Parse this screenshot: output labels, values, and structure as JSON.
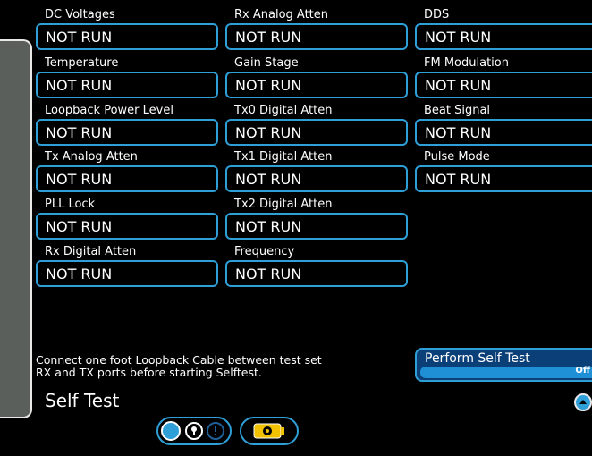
{
  "tests": {
    "dc_voltages": {
      "label": "DC Voltages",
      "value": "NOT RUN"
    },
    "temperature": {
      "label": "Temperature",
      "value": "NOT RUN"
    },
    "loopback_power_level": {
      "label": "Loopback Power Level",
      "value": "NOT RUN"
    },
    "tx_analog_atten": {
      "label": "Tx Analog Atten",
      "value": "NOT RUN"
    },
    "pll_lock": {
      "label": "PLL Lock",
      "value": "NOT RUN"
    },
    "rx_digital_atten": {
      "label": "Rx Digital Atten",
      "value": "NOT RUN"
    },
    "rx_analog_atten": {
      "label": "Rx Analog Atten",
      "value": "NOT RUN"
    },
    "gain_stage": {
      "label": "Gain Stage",
      "value": "NOT RUN"
    },
    "tx0_digital_atten": {
      "label": "Tx0 Digital Atten",
      "value": "NOT RUN"
    },
    "tx1_digital_atten": {
      "label": "Tx1 Digital Atten",
      "value": "NOT RUN"
    },
    "tx2_digital_atten": {
      "label": "Tx2 Digital Atten",
      "value": "NOT RUN"
    },
    "frequency": {
      "label": "Frequency",
      "value": "NOT RUN"
    },
    "dds": {
      "label": "DDS",
      "value": "NOT RUN"
    },
    "fm_modulation": {
      "label": "FM Modulation",
      "value": "NOT RUN"
    },
    "beat_signal": {
      "label": "Beat Signal",
      "value": "NOT RUN"
    },
    "pulse_mode": {
      "label": "Pulse Mode",
      "value": "NOT RUN"
    }
  },
  "instructions": {
    "line1": "Connect one foot Loopback Cable between test set",
    "line2": "RX and TX ports before starting Selftest."
  },
  "page": {
    "title": "Self Test"
  },
  "perform_self_test": {
    "label": "Perform Self Test",
    "state": "Off"
  },
  "colors": {
    "accent": "#2f9fd8",
    "panel": "#5b5f5b",
    "button_fill": "#0b3f78",
    "battery": "#f2c200"
  },
  "icons": {
    "scroll_up": "chevron-up-icon",
    "indicators": [
      "circle-icon",
      "key-lock-icon",
      "alert-icon"
    ],
    "battery": "battery-icon"
  }
}
